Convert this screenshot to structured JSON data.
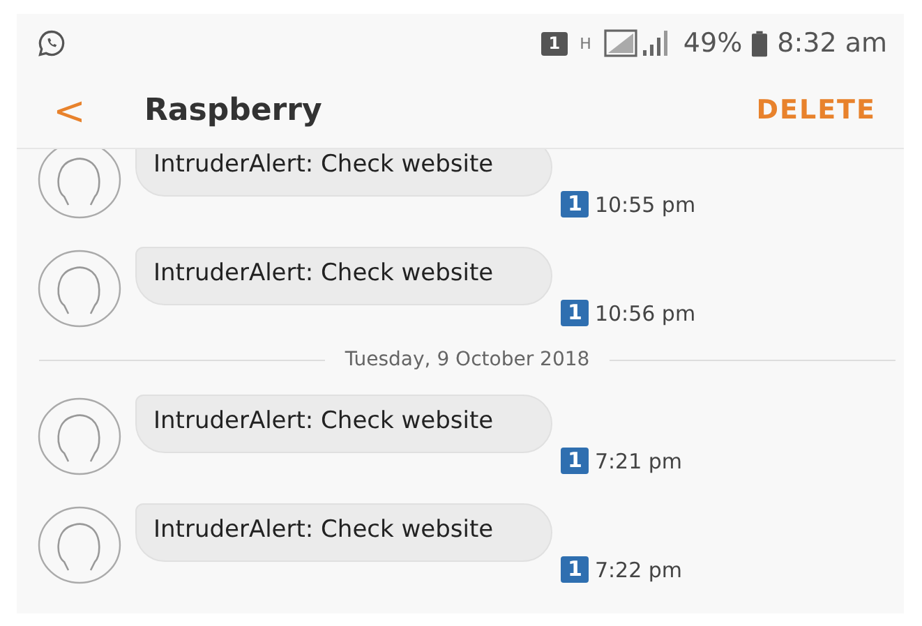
{
  "status_bar": {
    "sim": "1",
    "network": "H",
    "battery": "49%",
    "time": "8:32 am"
  },
  "app_bar": {
    "back": "<",
    "title": "Raspberry",
    "action": "DELETE"
  },
  "messages": [
    {
      "kind": "message",
      "text": "IntruderAlert: Check website",
      "sim": "1",
      "time": "10:55 pm"
    },
    {
      "kind": "message",
      "text": "IntruderAlert: Check website",
      "sim": "1",
      "time": "10:56 pm"
    },
    {
      "kind": "date",
      "text": "Tuesday, 9 October 2018"
    },
    {
      "kind": "message",
      "text": "IntruderAlert: Check website",
      "sim": "1",
      "time": "7:21 pm"
    },
    {
      "kind": "message",
      "text": "IntruderAlert: Check website",
      "sim": "1",
      "time": "7:22 pm"
    }
  ]
}
